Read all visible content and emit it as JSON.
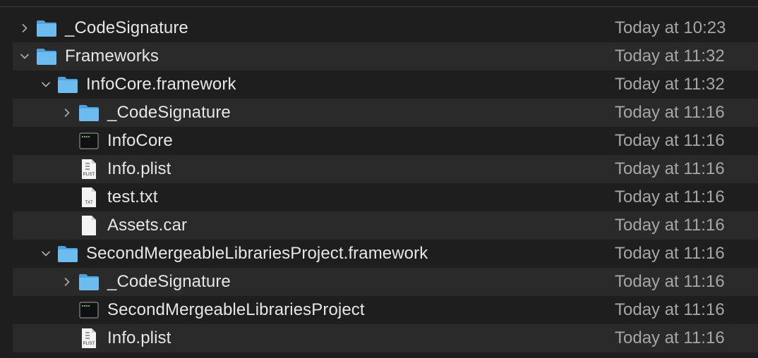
{
  "rows": [
    {
      "name": "_CodeSignature",
      "date": "Today at 10:23",
      "icon": "folder-icon",
      "disclosure": "collapsed",
      "level": 0
    },
    {
      "name": "Frameworks",
      "date": "Today at 11:32",
      "icon": "folder-icon",
      "disclosure": "expanded",
      "level": 0
    },
    {
      "name": "InfoCore.framework",
      "date": "Today at 11:32",
      "icon": "folder-icon",
      "disclosure": "expanded",
      "level": 1
    },
    {
      "name": "_CodeSignature",
      "date": "Today at 11:16",
      "icon": "folder-icon",
      "disclosure": "collapsed",
      "level": 2
    },
    {
      "name": "InfoCore",
      "date": "Today at 11:16",
      "icon": "executable-icon",
      "disclosure": "none",
      "level": 2
    },
    {
      "name": "Info.plist",
      "date": "Today at 11:16",
      "icon": "plist-file-icon",
      "icon_label": "PLIST",
      "disclosure": "none",
      "level": 2
    },
    {
      "name": "test.txt",
      "date": "Today at 11:16",
      "icon": "text-file-icon",
      "icon_label": "TXT",
      "disclosure": "none",
      "level": 2
    },
    {
      "name": "Assets.car",
      "date": "Today at 11:16",
      "icon": "document-icon",
      "disclosure": "none",
      "level": 2
    },
    {
      "name": "SecondMergeableLibrariesProject.framework",
      "date": "Today at 11:16",
      "icon": "folder-icon",
      "disclosure": "expanded",
      "level": 1
    },
    {
      "name": "_CodeSignature",
      "date": "Today at 11:16",
      "icon": "folder-icon",
      "disclosure": "collapsed",
      "level": 2
    },
    {
      "name": "SecondMergeableLibrariesProject",
      "date": "Today at 11:16",
      "icon": "executable-icon",
      "disclosure": "none",
      "level": 2
    },
    {
      "name": "Info.plist",
      "date": "Today at 11:16",
      "icon": "plist-file-icon",
      "icon_label": "PLIST",
      "disclosure": "none",
      "level": 2
    }
  ],
  "colors": {
    "background": "#1e1e1e",
    "alt_row": "#2a2a2a",
    "text": "#e6e6e6",
    "date_text": "#a6a6a6",
    "folder_blue": "#4aa3df",
    "folder_tab": "#6cbcf0"
  }
}
